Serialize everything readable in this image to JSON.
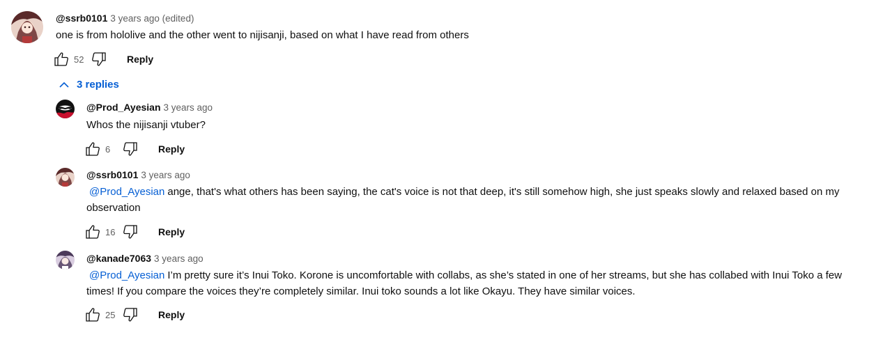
{
  "colors": {
    "accent_link": "#065fd4",
    "meta_gray": "#606060",
    "text": "#0f0f0f"
  },
  "top_comment": {
    "author": "@ssrb0101",
    "meta": "3 years ago (edited)",
    "text": "one is from hololive and the other went to nijisanji, based on what I have read from others",
    "likes": "52",
    "reply_label": "Reply",
    "avatar_icon": "anime-avatar-icon"
  },
  "replies_toggle": {
    "label": "3 replies",
    "icon": "chevron-up-icon"
  },
  "replies": [
    {
      "author": "@Prod_Ayesian",
      "meta": "3 years ago",
      "mention": "",
      "text": "Whos the nijisanji vtuber?",
      "likes": "6",
      "reply_label": "Reply",
      "avatar_icon": "red-black-avatar-icon"
    },
    {
      "author": "@ssrb0101",
      "meta": "3 years ago",
      "mention": "@Prod_Ayesian",
      "text": "ange, that's what others has been saying, the cat's voice is not that deep, it's still somehow high, she just speaks slowly and relaxed based on my observation",
      "likes": "16",
      "reply_label": "Reply",
      "avatar_icon": "anime-avatar-icon"
    },
    {
      "author": "@kanade7063",
      "meta": "3 years ago",
      "mention": "@Prod_Ayesian",
      "text": "I’m pretty sure it’s Inui Toko. Korone is uncomfortable with collabs, as she’s stated in one of her streams, but she has collabed with Inui Toko a few times! If you compare the voices they’re completely similar. Inui toko sounds a lot like Okayu. They have similar voices.",
      "likes": "25",
      "reply_label": "Reply",
      "avatar_icon": "anime-girl-avatar-icon"
    }
  ]
}
